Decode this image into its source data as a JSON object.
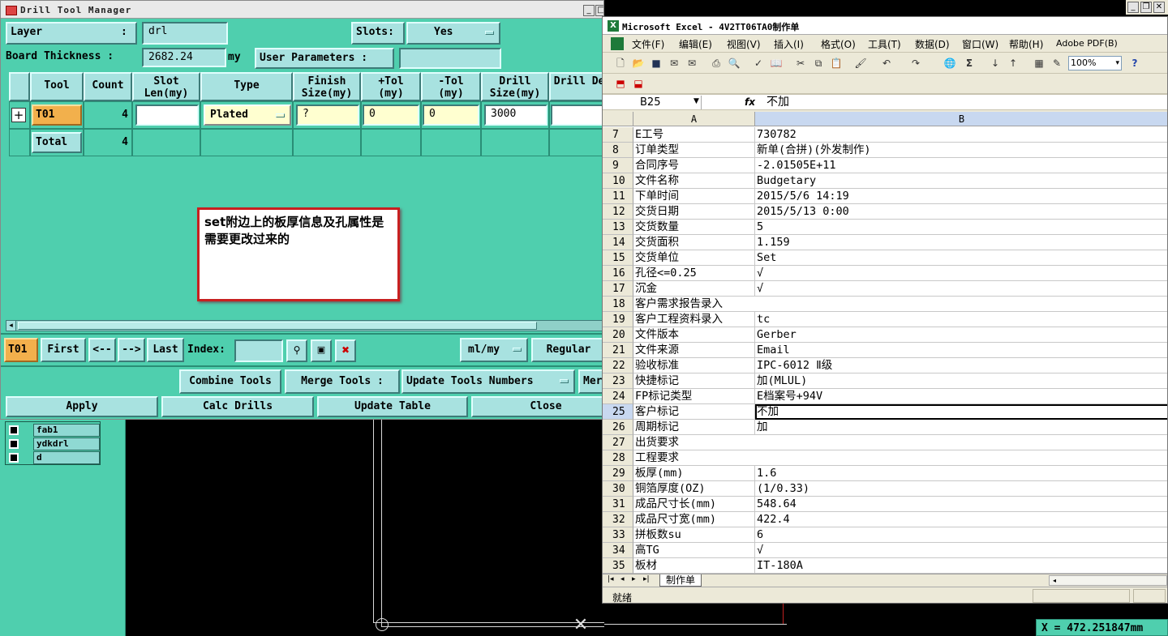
{
  "dtm": {
    "title": "Drill Tool Manager",
    "layer_label": "Layer",
    "layer_colon": ":",
    "layer_value": "drl",
    "slots_label": "Slots:",
    "slots_value": "Yes",
    "board_thickness_label": "Board Thickness :",
    "board_thickness_value": "2682.24",
    "board_thickness_unit": "my",
    "user_params_label": "User Parameters :",
    "user_params_value": "",
    "columns": [
      "Tool",
      "Count",
      "Slot Len(my)",
      "Type",
      "Finish Size(my)",
      "+Tol (my)",
      "-Tol (my)",
      "Drill Size(my)",
      "Drill Des"
    ],
    "row1": {
      "tool": "T01",
      "count": "4",
      "slot_len": "",
      "type": "Plated",
      "finish": "?",
      "plus_tol": "0",
      "minus_tol": "0",
      "drill_size": "3000",
      "drill_des": ""
    },
    "total_row": {
      "label": "Total",
      "count": "4"
    },
    "expand_icon": "plus-icon",
    "annotation": "set附边上的板厚信息及孔属性是需要更改过来的",
    "nav": {
      "current": "T01",
      "first": "First",
      "prev": "<--",
      "next": "-->",
      "last": "Last",
      "index_label": "Index:",
      "index_value": "",
      "units": "ml/my",
      "regular": "Regular"
    },
    "actions": {
      "combine": "Combine Tools",
      "merge": "Merge Tools :",
      "update_numbers": "Update Tools Numbers",
      "more": "Mer"
    },
    "bottom": {
      "apply": "Apply",
      "calc": "Calc Drills",
      "update_table": "Update Table",
      "close": "Close"
    }
  },
  "cad": {
    "layers": [
      "fab1",
      "ydkdrl",
      "d"
    ],
    "coord_readout": "X = 472.251847mm"
  },
  "excel": {
    "title": "Microsoft Excel - 4V2TT06TA0制作单",
    "menu": [
      "文件(F)",
      "编辑(E)",
      "视图(V)",
      "插入(I)",
      "格式(O)",
      "工具(T)",
      "数据(D)",
      "窗口(W)",
      "帮助(H)",
      "Adobe PDF(B)"
    ],
    "zoom": "100%",
    "name_box": "B25",
    "fx": "fx",
    "formula_value": "不加",
    "col_a": "A",
    "col_b": "B",
    "rows": [
      {
        "n": "7",
        "a": "E工号",
        "b": "730782"
      },
      {
        "n": "8",
        "a": "订单类型",
        "b": "新单(合拼)(外发制作)"
      },
      {
        "n": "9",
        "a": "合同序号",
        "b": "-2.01505E+11"
      },
      {
        "n": "10",
        "a": "文件名称",
        "b": "Budgetary"
      },
      {
        "n": "11",
        "a": "下单时间",
        "b": "2015/5/6 14:19"
      },
      {
        "n": "12",
        "a": "交货日期",
        "b": "2015/5/13 0:00"
      },
      {
        "n": "13",
        "a": "交货数量",
        "b": "5"
      },
      {
        "n": "14",
        "a": "交货面积",
        "b": "1.159"
      },
      {
        "n": "15",
        "a": "交货单位",
        "b": "Set"
      },
      {
        "n": "16",
        "a": "孔径<=0.25",
        "b": "√"
      },
      {
        "n": "17",
        "a": "沉金",
        "b": "√"
      },
      {
        "n": "18",
        "a": "客户需求报告录入",
        "b": ""
      },
      {
        "n": "19",
        "a": "客户工程资料录入",
        "b": "tc"
      },
      {
        "n": "20",
        "a": "文件版本",
        "b": "Gerber"
      },
      {
        "n": "21",
        "a": "文件来源",
        "b": "Email"
      },
      {
        "n": "22",
        "a": "验收标准",
        "b": "IPC-6012 Ⅱ级"
      },
      {
        "n": "23",
        "a": "快捷标记",
        "b": "加(MLUL)"
      },
      {
        "n": "24",
        "a": "FP标记类型",
        "b": "E档案号+94V"
      },
      {
        "n": "25",
        "a": "客户标记",
        "b": "不加"
      },
      {
        "n": "26",
        "a": "周期标记",
        "b": "加"
      },
      {
        "n": "27",
        "a": "出货要求",
        "b": ""
      },
      {
        "n": "28",
        "a": "工程要求",
        "b": ""
      },
      {
        "n": "29",
        "a": "板厚(mm)",
        "b": "1.6"
      },
      {
        "n": "30",
        "a": "铜箔厚度(OZ)",
        "b": " (1/0.33)"
      },
      {
        "n": "31",
        "a": "成品尺寸长(mm)",
        "b": "548.64"
      },
      {
        "n": "32",
        "a": "成品尺寸宽(mm)",
        "b": "422.4"
      },
      {
        "n": "33",
        "a": "拼板数su",
        "b": "6"
      },
      {
        "n": "34",
        "a": "高TG",
        "b": "√"
      },
      {
        "n": "35",
        "a": "板材",
        "b": "IT-180A"
      }
    ],
    "active_row": "25",
    "sheet_tab": "制作单",
    "status": "就绪"
  }
}
